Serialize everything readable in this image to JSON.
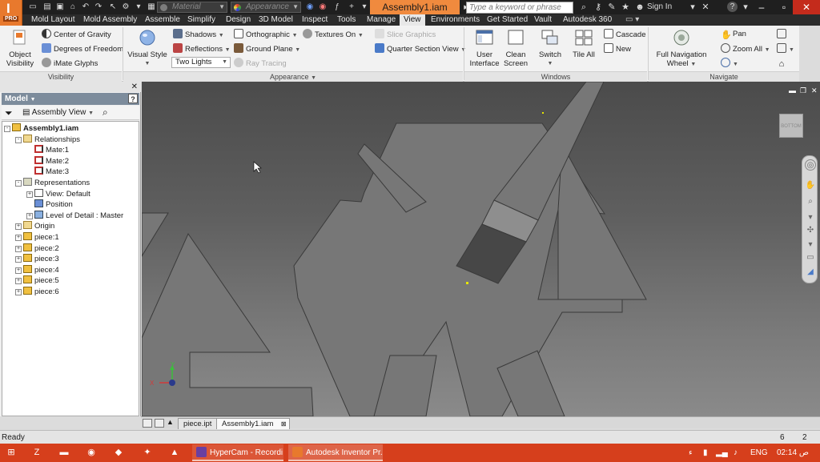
{
  "app": {
    "logo": "I",
    "edition": "PRO",
    "document_title": "Assembly1.iam",
    "search_placeholder": "Type a keyword or phrase",
    "sign_in": "Sign In",
    "qat": {
      "material_placeholder": "Material",
      "appearance_placeholder": "Appearance"
    }
  },
  "tabs": [
    "Mold Layout",
    "Mold Assembly",
    "Assemble",
    "Simplify",
    "Design",
    "3D Model",
    "Inspect",
    "Tools",
    "Manage",
    "View",
    "Environments",
    "Get Started",
    "Vault",
    "Autodesk 360"
  ],
  "active_tab": "View",
  "ribbon": {
    "visibility": {
      "label": "Visibility",
      "object_visibility_line1": "Object",
      "object_visibility_line2": "Visibility",
      "center_of_gravity": "Center of Gravity",
      "degrees_of_freedom": "Degrees of Freedom",
      "imate_glyphs": "iMate Glyphs"
    },
    "appearance": {
      "label": "Appearance",
      "visual_style": "Visual Style",
      "shadows": "Shadows",
      "reflections": "Reflections",
      "lighting": "Two Lights",
      "orthographic": "Orthographic",
      "ground_plane": "Ground Plane",
      "ray_tracing": "Ray Tracing",
      "textures_on": "Textures On",
      "slice_graphics": "Slice Graphics",
      "quarter_section_view": "Quarter Section View"
    },
    "windows": {
      "label": "Windows",
      "user_interface_line1": "User",
      "user_interface_line2": "Interface",
      "clean_screen_line1": "Clean",
      "clean_screen_line2": "Screen",
      "switch": "Switch",
      "tile_all": "Tile All",
      "cascade": "Cascade",
      "new": "New"
    },
    "navigate": {
      "label": "Navigate",
      "full_nav_wheel_line1": "Full Navigation",
      "full_nav_wheel_line2": "Wheel",
      "pan": "Pan",
      "zoom_all": "Zoom All"
    }
  },
  "browser": {
    "title": "Model",
    "view_selector": "Assembly View",
    "help": "?",
    "tree": [
      {
        "label": "Assembly1.iam",
        "level": 0,
        "icon": "assembly-icon",
        "bold": true,
        "expander": "-"
      },
      {
        "label": "Relationships",
        "level": 1,
        "icon": "folder-open-icon",
        "expander": "-"
      },
      {
        "label": "Mate:1",
        "level": 2,
        "icon": "mate-icon",
        "expander": ""
      },
      {
        "label": "Mate:2",
        "level": 2,
        "icon": "mate-icon",
        "expander": ""
      },
      {
        "label": "Mate:3",
        "level": 2,
        "icon": "mate-icon",
        "expander": ""
      },
      {
        "label": "Representations",
        "level": 1,
        "icon": "representations-icon",
        "expander": "-"
      },
      {
        "label": "View: Default",
        "level": 2,
        "icon": "view-rep-icon",
        "expander": "+"
      },
      {
        "label": "Position",
        "level": 2,
        "icon": "position-icon",
        "expander": ""
      },
      {
        "label": "Level of Detail : Master",
        "level": 2,
        "icon": "lod-icon",
        "expander": "+"
      },
      {
        "label": "Origin",
        "level": 1,
        "icon": "folder-icon",
        "expander": "+"
      },
      {
        "label": "piece:1",
        "level": 1,
        "icon": "part-icon",
        "expander": "+"
      },
      {
        "label": "piece:2",
        "level": 1,
        "icon": "part-icon",
        "expander": "+"
      },
      {
        "label": "piece:3",
        "level": 1,
        "icon": "part-icon",
        "expander": "+"
      },
      {
        "label": "piece:4",
        "level": 1,
        "icon": "part-icon",
        "expander": "+"
      },
      {
        "label": "piece:5",
        "level": 1,
        "icon": "part-icon",
        "expander": "+"
      },
      {
        "label": "piece:6",
        "level": 1,
        "icon": "part-icon",
        "expander": "+"
      }
    ]
  },
  "viewcube_label": "BOTTOM",
  "triad": {
    "x": "X",
    "y": "Y"
  },
  "doc_tabs": [
    {
      "label": "piece.ipt",
      "active": false
    },
    {
      "label": "Assembly1.iam",
      "active": true
    }
  ],
  "status": {
    "text": "Ready",
    "count1": "6",
    "count2": "2"
  },
  "taskbar": {
    "tasks": [
      "HyperCam - Recordi...",
      "Autodesk Inventor Pr..."
    ],
    "language": "ENG",
    "time": "02:14 ص"
  },
  "colors": {
    "accent_orange": "#e8792d",
    "taskbar_red": "#d63f1c",
    "part_gray": "#777777"
  }
}
